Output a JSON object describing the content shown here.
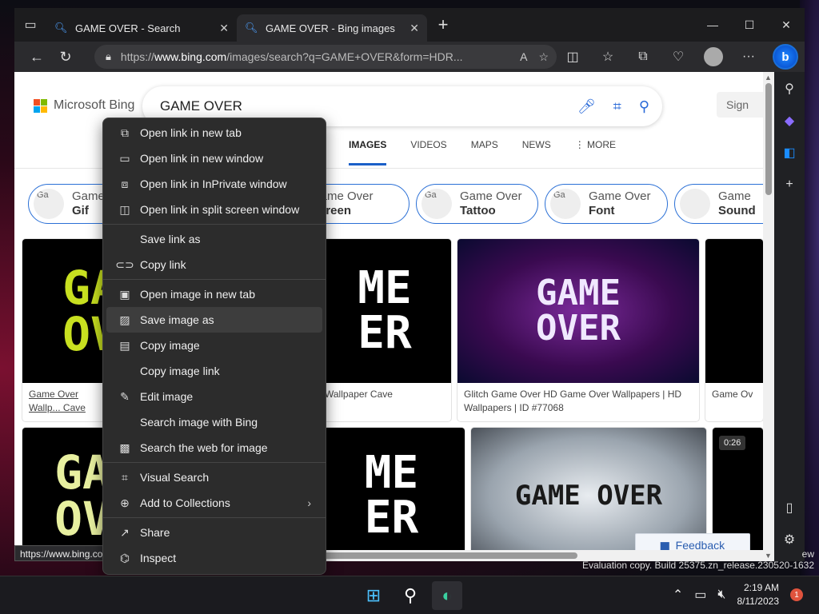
{
  "tabs": [
    {
      "title": "GAME OVER - Search",
      "icon": "search-icon"
    },
    {
      "title": "GAME OVER - Bing images",
      "icon": "search-icon"
    }
  ],
  "address": {
    "prefix": "https://",
    "domain": "www.bing.com",
    "path": "/images/search?q=GAME+OVER&form=HDR..."
  },
  "bing": {
    "logo_text": "Microsoft Bing",
    "query": "GAME OVER",
    "signin": "Sign"
  },
  "nav": [
    "IMAGES",
    "VIDEOS",
    "MAPS",
    "NEWS",
    "⋮ MORE"
  ],
  "pills": [
    {
      "alt": "Ga",
      "line1": "Game",
      "line2": "Gif"
    },
    {
      "alt": "",
      "line1": "Game Over",
      "line2": "Screen"
    },
    {
      "alt": "Ga",
      "line1": "Game Over",
      "line2": "Tattoo"
    },
    {
      "alt": "Ga",
      "line1": "Game Over",
      "line2": "Font"
    },
    {
      "alt": "",
      "line1": "Game",
      "line2": "Sound"
    }
  ],
  "cards": [
    {
      "caption": "Game Over Wallp... Cave",
      "art1": "GA",
      "art2": "OV"
    },
    {
      "caption": "Wallpaper Cave",
      "art1": "ME",
      "art2": "ER"
    },
    {
      "caption": "Glitch Game Over HD Game Over Wallpapers | HD Wallpapers | ID #77068",
      "art1": "GAME",
      "art2": "OVER"
    },
    {
      "caption": "Game Ov",
      "art1": "",
      "art2": ""
    },
    {
      "caption": "",
      "art1": "GA",
      "art2": "OV"
    },
    {
      "caption": "",
      "art1": "ME",
      "art2": "ER"
    },
    {
      "caption": "",
      "art1": "GAME OVER",
      "art2": ""
    },
    {
      "caption": "",
      "badge": "0:26"
    }
  ],
  "context_menu": [
    {
      "label": "Open link in new tab",
      "icon": "new-tab-icon"
    },
    {
      "label": "Open link in new window",
      "icon": "window-icon"
    },
    {
      "label": "Open link in InPrivate window",
      "icon": "inprivate-icon"
    },
    {
      "label": "Open link in split screen window",
      "icon": "split-screen-icon"
    },
    {
      "sep": true
    },
    {
      "label": "Save link as",
      "icon": ""
    },
    {
      "label": "Copy link",
      "icon": "link-icon"
    },
    {
      "sep": true
    },
    {
      "label": "Open image in new tab",
      "icon": "image-icon"
    },
    {
      "label": "Save image as",
      "icon": "save-image-icon",
      "hover": true
    },
    {
      "label": "Copy image",
      "icon": "copy-image-icon"
    },
    {
      "label": "Copy image link",
      "icon": ""
    },
    {
      "label": "Edit image",
      "icon": "edit-image-icon"
    },
    {
      "label": "Search image with Bing",
      "icon": ""
    },
    {
      "label": "Search the web for image",
      "icon": "search-web-icon"
    },
    {
      "sep": true
    },
    {
      "label": "Visual Search",
      "icon": "visual-search-icon"
    },
    {
      "label": "Add to Collections",
      "icon": "collections-icon",
      "submenu": true
    },
    {
      "sep": true
    },
    {
      "label": "Share",
      "icon": "share-icon"
    },
    {
      "label": "Inspect",
      "icon": "inspect-icon"
    }
  ],
  "feedback": "Feedback",
  "status_url": "https://www.bing.com/images/search?view=detailV2&...",
  "watermark": {
    "line1": "ew",
    "line2": "Evaluation copy. Build 25375.zn_release.230520-1632"
  },
  "clock": {
    "time": "2:19 AM",
    "date": "8/11/2023"
  },
  "notifications": "1"
}
